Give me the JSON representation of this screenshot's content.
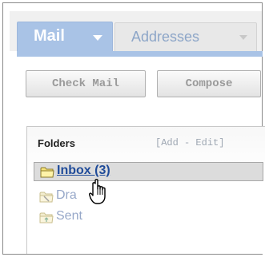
{
  "tabs": {
    "mail": "Mail",
    "addresses": "Addresses"
  },
  "toolbar": {
    "check_mail": "Check Mail",
    "compose": "Compose"
  },
  "folders": {
    "title": "Folders",
    "actions_open": "[",
    "add": "Add",
    "separator": " - ",
    "edit": "Edit",
    "actions_close": "]",
    "items": [
      {
        "label": "Inbox (3)",
        "icon": "inbox-folder-icon"
      },
      {
        "label": "Dra",
        "icon": "drafts-folder-icon"
      },
      {
        "label": "Sent",
        "icon": "sent-folder-icon"
      }
    ]
  },
  "colors": {
    "accent": "#a9c3e6",
    "selected_row": "#dcdcdc",
    "inbox_link": "#1f4b99",
    "muted_link": "#97a8c9"
  }
}
